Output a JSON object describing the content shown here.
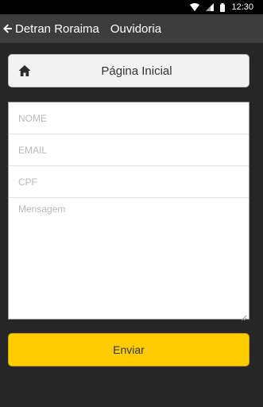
{
  "status_bar": {
    "time": "12:30",
    "icons": [
      "wifi-icon",
      "signal-icon",
      "battery-icon"
    ]
  },
  "app_bar": {
    "back_icon": "arrow-left-icon",
    "title": "Detran Roraima",
    "subtitle": "Ouvidoria"
  },
  "home": {
    "icon": "home-icon",
    "label": "Página Inicial"
  },
  "form": {
    "name_placeholder": "NOME",
    "name_value": "",
    "email_placeholder": "EMAIL",
    "email_value": "",
    "cpf_placeholder": "CPF",
    "cpf_value": "",
    "message_placeholder": "Mensagem",
    "message_value": ""
  },
  "submit": {
    "label": "Enviar"
  },
  "colors": {
    "background": "#262626",
    "app_bar": "#3d3d3d",
    "status_bar": "#000000",
    "accent_button": "#ffcc00",
    "card": "#f2f2f2"
  }
}
